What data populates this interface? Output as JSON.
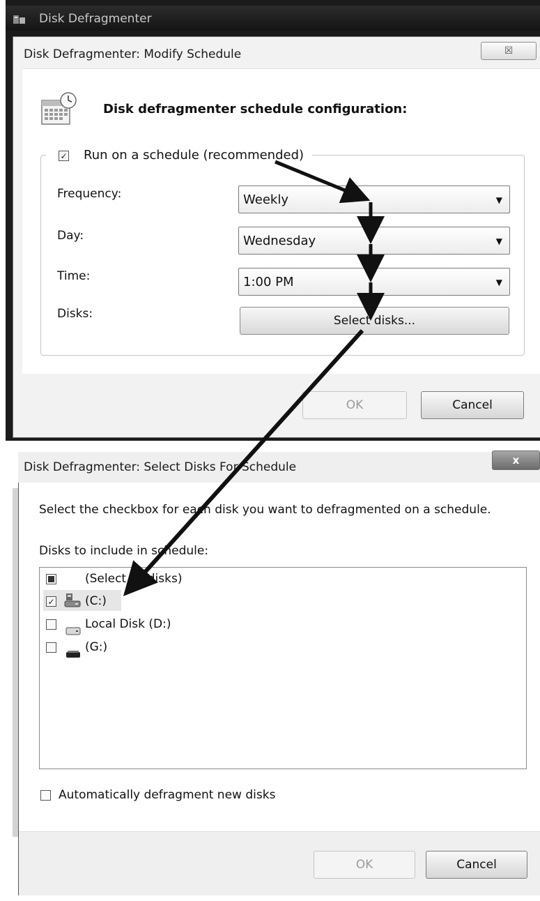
{
  "parent_window": {
    "title": "Disk Defragmenter",
    "icon": "defragmenter-app-icon"
  },
  "modify_schedule_dialog": {
    "title": "Disk Defragmenter: Modify Schedule",
    "close_glyph": "☒",
    "icon": "calendar-clock-icon",
    "heading": "Disk defragmenter schedule configuration:",
    "run_on_schedule": {
      "label": "Run on a schedule (recommended)",
      "checked": true,
      "check_glyph": "✓"
    },
    "frequency": {
      "label": "Frequency:",
      "value": "Weekly"
    },
    "day": {
      "label": "Day:",
      "value": "Wednesday"
    },
    "time": {
      "label": "Time:",
      "value": "1:00 PM"
    },
    "disks": {
      "label": "Disks:",
      "button": "Select disks..."
    },
    "ok_label": "OK",
    "cancel_label": "Cancel",
    "dropdown_glyph": "▼"
  },
  "select_disks_dialog": {
    "title": "Disk Defragmenter: Select Disks For Schedule",
    "close_glyph": "x",
    "instruction": "Select the checkbox for each disk you want to defragmented on a schedule.",
    "list_label": "Disks to include in schedule:",
    "select_all_label": "(Select all disks)",
    "disks": [
      {
        "label": "(C:)",
        "checked": true,
        "icon": "system-drive-icon"
      },
      {
        "label": "Local Disk (D:)",
        "checked": false,
        "icon": "hard-drive-icon"
      },
      {
        "label": "(G:)",
        "checked": false,
        "icon": "external-drive-icon"
      }
    ],
    "auto_defrag": {
      "label": "Automatically defragment new disks",
      "checked": false
    },
    "ok_label": "OK",
    "cancel_label": "Cancel",
    "check_glyph": "✓"
  },
  "colors": {
    "window_dark": "#1b1b1b",
    "dialog_bg": "#f2f2f2",
    "content_bg": "#ffffff",
    "arrow": "#111111"
  }
}
